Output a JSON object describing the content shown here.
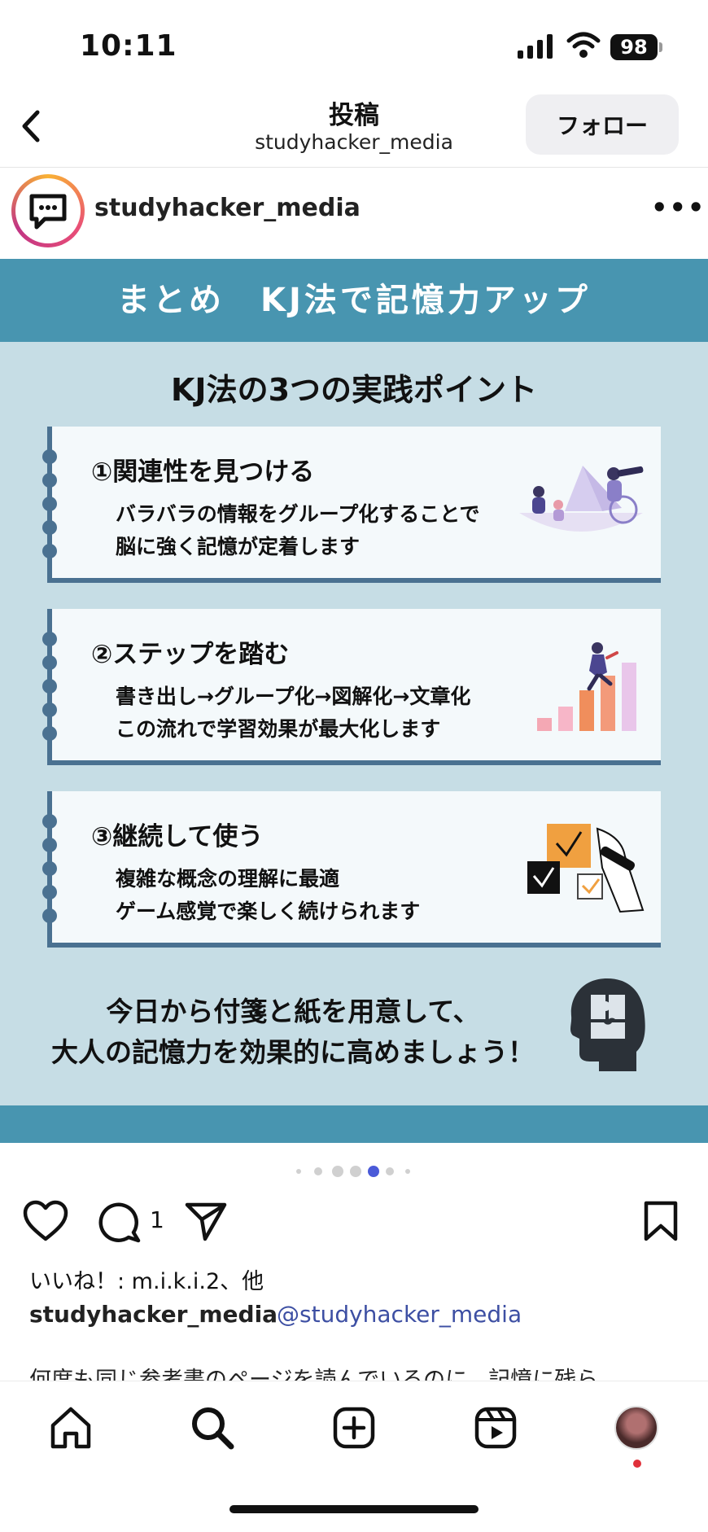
{
  "status_bar": {
    "time": "10:11",
    "battery": "98"
  },
  "header": {
    "title": "投稿",
    "subtitle": "studyhacker_media",
    "follow_label": "フォロー"
  },
  "post": {
    "username": "studyhacker_media",
    "more_label": "•••",
    "slide": {
      "banner": "まとめ　KJ法で記憶力アップ",
      "heading": "KJ法の3つの実践ポイント",
      "cards": [
        {
          "title": "①関連性を見つける",
          "line1": "バラバラの情報をグループ化することで",
          "line2": "脳に強く記憶が定着します"
        },
        {
          "title": "②ステップを踏む",
          "line1": "書き出し→グループ化→図解化→文章化",
          "line2": "この流れで学習効果が最大化します"
        },
        {
          "title": "③継続して使う",
          "line1": "複雑な概念の理解に最適",
          "line2": "ゲーム感覚で楽しく続けられます"
        }
      ],
      "closing_line1": "今日から付箋と紙を用意して、",
      "closing_line2": "大人の記憶力を効果的に高めましょう！"
    },
    "carousel": {
      "total": 7,
      "active": 4
    },
    "comment_count": "1",
    "likes_text": "いいね！: m.i.k.i.2、他",
    "caption_user": "studyhacker_media",
    "caption_mention": "@studyhacker_media",
    "caption_text": "何度も同じ参考書のページを読んでいるのに、記憶に残ら"
  },
  "colors": {
    "banner": "#4895b0",
    "slide_bg": "#c6dde5",
    "card_accent": "#4a7191",
    "mention": "#3d4fa3"
  },
  "icons": [
    "chevron-left-icon",
    "speech-bubble-icon",
    "heart-icon",
    "comment-icon",
    "send-icon",
    "bookmark-icon",
    "home-icon",
    "search-icon",
    "add-icon",
    "reels-icon",
    "brain-puzzle-icon"
  ]
}
